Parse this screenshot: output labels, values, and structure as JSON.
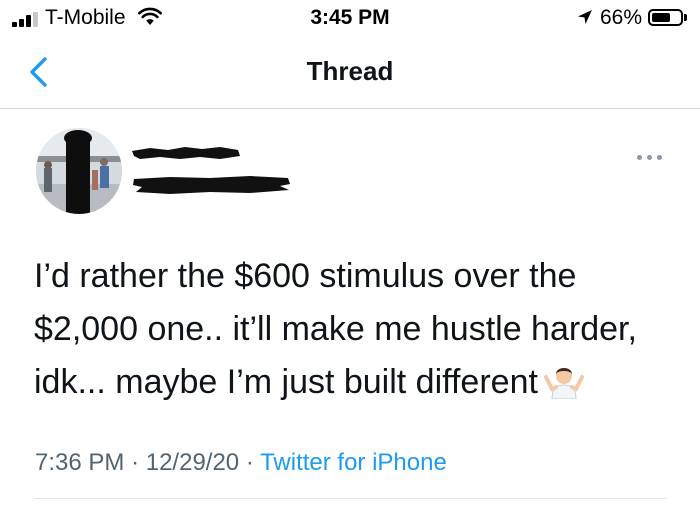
{
  "status_bar": {
    "carrier": "T-Mobile",
    "time": "3:45 PM",
    "battery_percent": "66%",
    "battery_level": 0.66,
    "signal_bars": 4,
    "signal_active_bars": 3
  },
  "nav": {
    "title": "Thread",
    "back_icon": "chevron-left-icon",
    "accent_color": "#1d9bf0"
  },
  "tweet": {
    "author_name": "",
    "author_handle": "",
    "author_redacted": true,
    "more_icon": "ellipsis-icon",
    "lines": [
      "I’d rather the $600 stimulus over the",
      "$2,000 one.. it’ll make me hustle harder,",
      "idk... maybe I’m just built different"
    ],
    "emoji": "man-shrugging-emoji",
    "time": "7:36 PM",
    "separator": "·",
    "date": "12/29/20",
    "source": "Twitter for iPhone"
  }
}
